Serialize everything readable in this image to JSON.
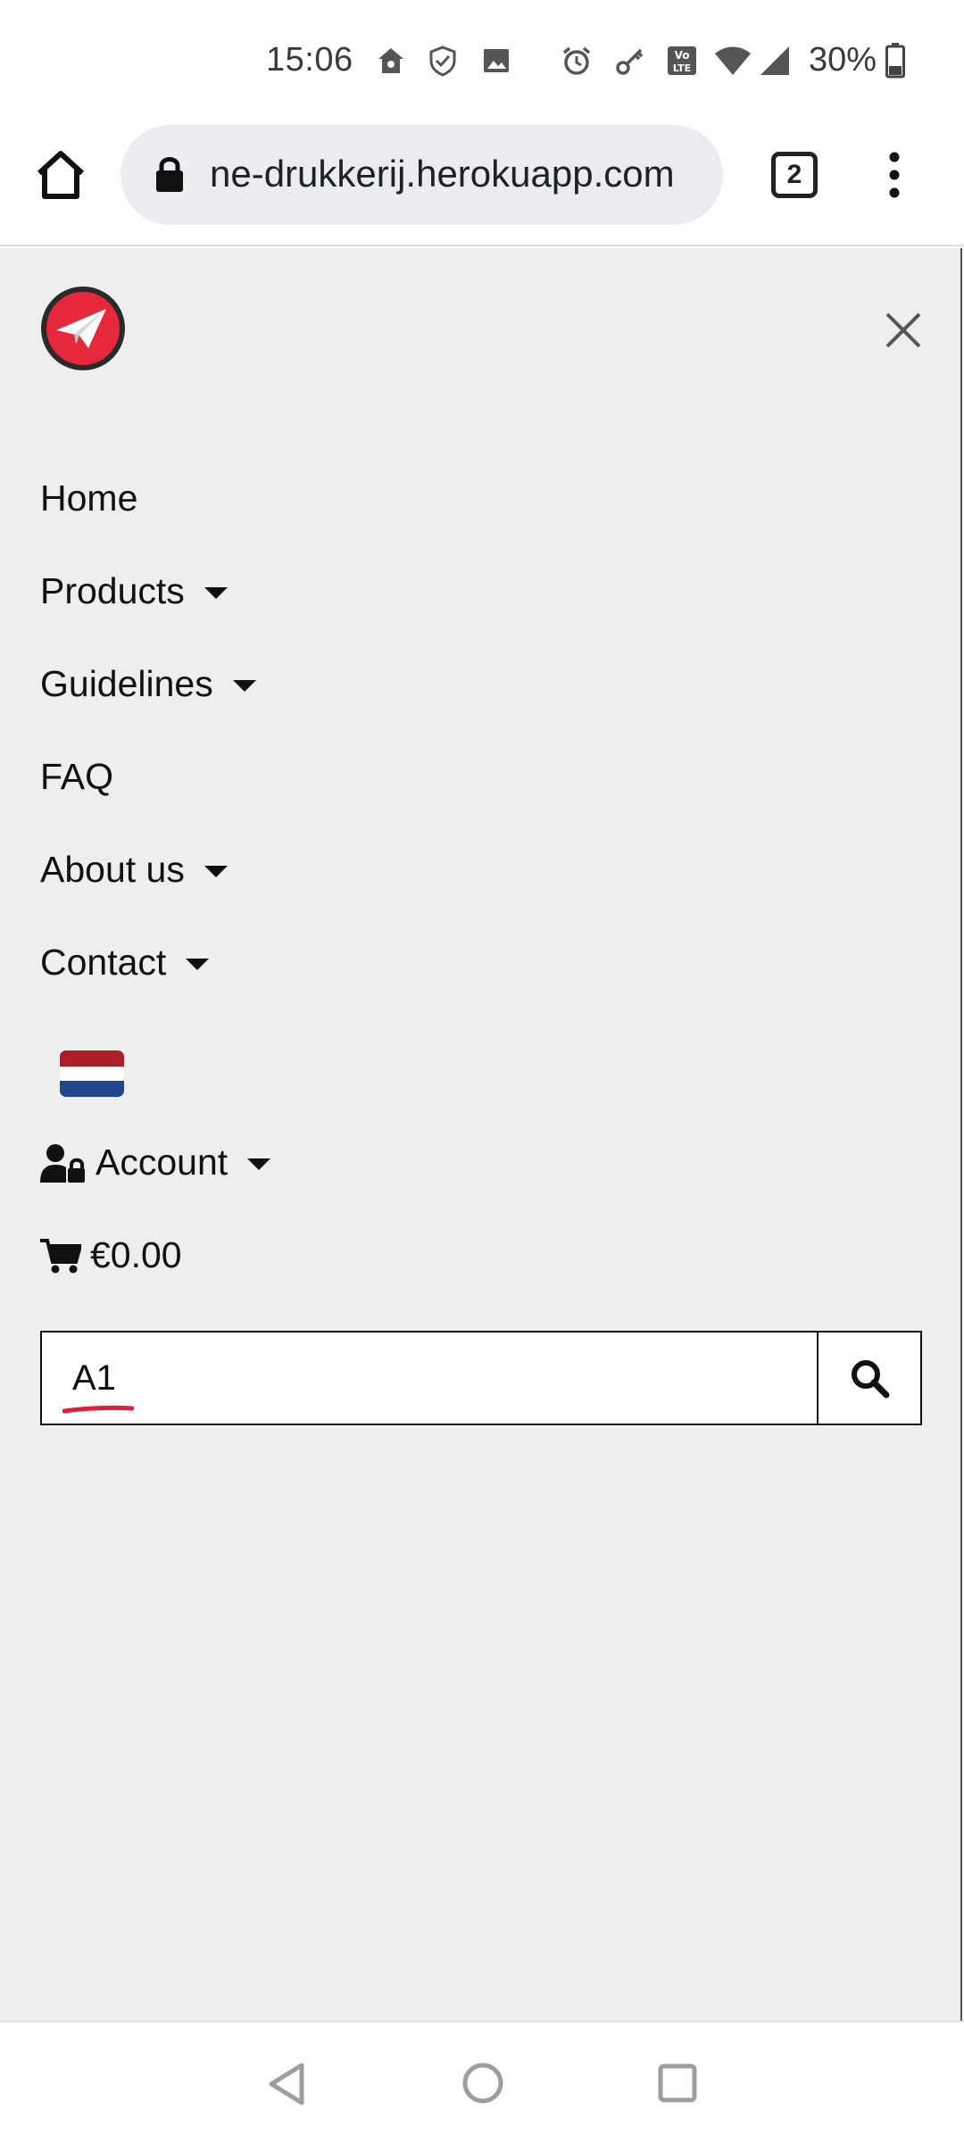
{
  "status_bar": {
    "time": "15:06",
    "battery": "30%",
    "icons": [
      "home-network-icon",
      "shield-check-icon",
      "image-icon",
      "alarm-icon",
      "key-icon",
      "volte-icon",
      "wifi-icon",
      "signal-icon",
      "battery-icon"
    ]
  },
  "browser": {
    "url": "ne-drukkerij.herokuapp.com",
    "tab_count": "2"
  },
  "menu": {
    "items": [
      {
        "label": "Home",
        "has_dropdown": false
      },
      {
        "label": "Products",
        "has_dropdown": true
      },
      {
        "label": "Guidelines",
        "has_dropdown": true
      },
      {
        "label": "FAQ",
        "has_dropdown": false
      },
      {
        "label": "About us",
        "has_dropdown": true
      },
      {
        "label": "Contact",
        "has_dropdown": true
      }
    ],
    "language_flag": "netherlands-flag-icon",
    "account_label": "Account",
    "cart_total": "€0.00"
  },
  "search": {
    "value": "A1"
  },
  "colors": {
    "brand_red": "#e5283c",
    "panel_bg": "#eeeeee",
    "spellcheck_red": "#e01e3c"
  }
}
